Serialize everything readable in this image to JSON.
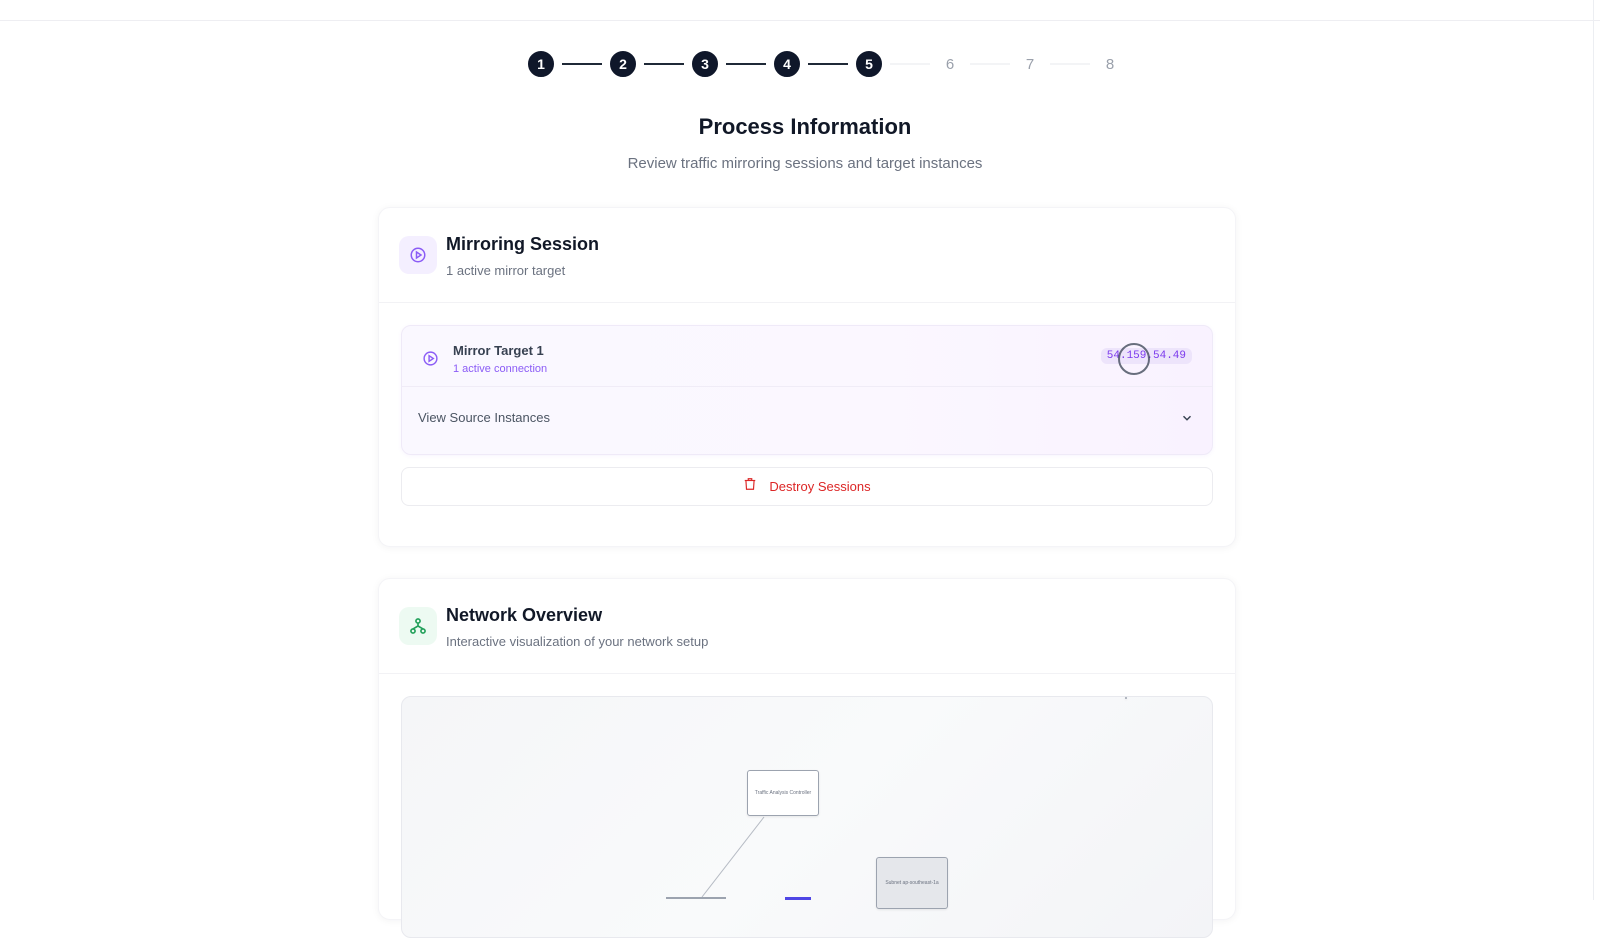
{
  "stepper": {
    "steps": [
      {
        "label": "1",
        "state": "done"
      },
      {
        "label": "2",
        "state": "done"
      },
      {
        "label": "3",
        "state": "done"
      },
      {
        "label": "4",
        "state": "done"
      },
      {
        "label": "5",
        "state": "done"
      },
      {
        "label": "6",
        "state": "todo"
      },
      {
        "label": "7",
        "state": "todo"
      },
      {
        "label": "8",
        "state": "todo"
      }
    ]
  },
  "page": {
    "title": "Process Information",
    "subtitle": "Review traffic mirroring sessions and target instances"
  },
  "mirroring": {
    "icon": "play-circle-icon",
    "title": "Mirroring Session",
    "subtitle": "1 active mirror target",
    "target": {
      "name": "Mirror Target 1",
      "connections": "1 active connection",
      "ip": "54.159.54.49"
    },
    "view_sources_label": "View Source Instances",
    "destroy_label": "Destroy Sessions"
  },
  "network": {
    "icon": "network-icon",
    "title": "Network Overview",
    "subtitle": "Interactive visualization of your network setup",
    "nodes": {
      "controller": "Traffic Analysis Controller",
      "subnet": "Subnet ap-southeast-1a"
    }
  },
  "colors": {
    "accent": "#7c3aed",
    "danger": "#dc2626",
    "step_done": "#0f172a",
    "step_todo": "#9aa0ab"
  }
}
